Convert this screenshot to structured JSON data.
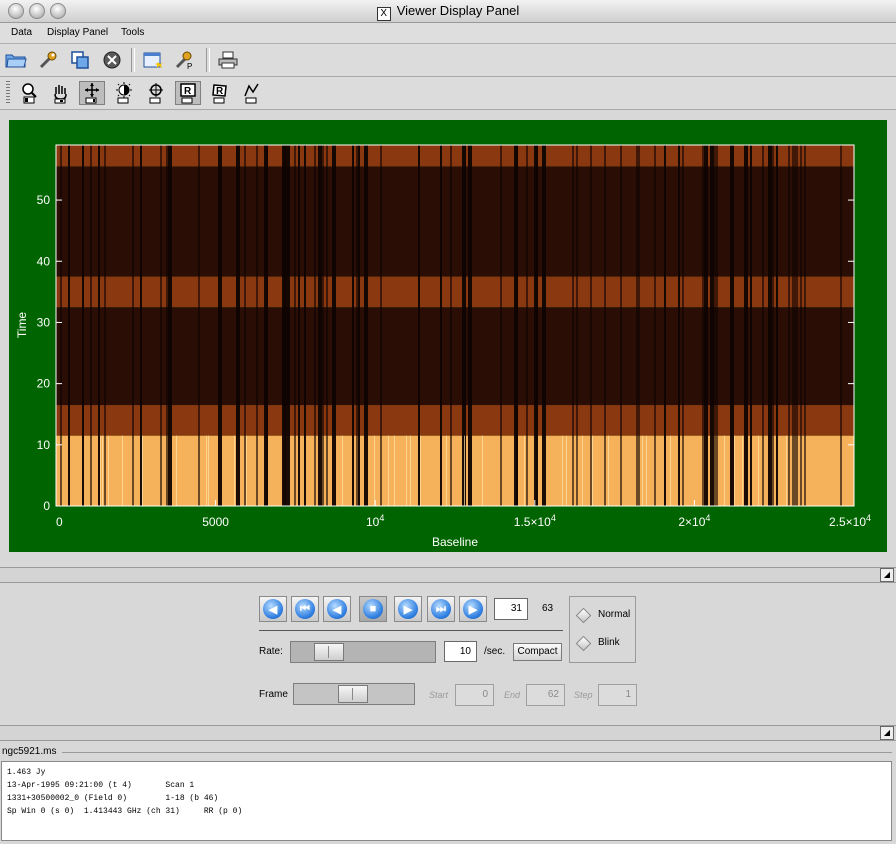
{
  "window": {
    "title": "Viewer Display Panel"
  },
  "menubar": {
    "items": [
      "Data",
      "Display Panel",
      "Tools"
    ]
  },
  "toolbar1": {
    "icons": [
      "open-folder-icon",
      "wrench-icon",
      "copy-panels-icon",
      "close-circle-icon",
      "new-panel-icon",
      "panel-wrench-icon",
      "printer-icon"
    ]
  },
  "toolbar2": {
    "icons": [
      "zoom-icon",
      "pan-hand-icon",
      "move-cross-icon",
      "contrast-icon",
      "crosshair-icon",
      "rectangle-region-icon",
      "polygon-region-icon",
      "polyline-icon"
    ],
    "pressed_index": 2
  },
  "plot": {
    "x_label": "Baseline",
    "y_label": "Time",
    "x_ticks": [
      "0",
      "5000",
      "10",
      "1.5×10",
      "2×10",
      "2.5×10"
    ],
    "x_tick_sup": "4",
    "y_ticks": [
      "0",
      "10",
      "20",
      "30",
      "40",
      "50"
    ],
    "x_range": [
      0,
      25000
    ],
    "y_range": [
      0,
      59
    ],
    "bands": [
      {
        "y0": 0,
        "y1": 11.5,
        "level": "bright"
      },
      {
        "y0": 11.5,
        "y1": 16.5,
        "level": "mid"
      },
      {
        "y0": 16.5,
        "y1": 32.5,
        "level": "dark"
      },
      {
        "y0": 32.5,
        "y1": 37.5,
        "level": "mid"
      },
      {
        "y0": 37.5,
        "y1": 55.5,
        "level": "dark"
      },
      {
        "y0": 55.5,
        "y1": 59,
        "level": "mid"
      }
    ],
    "colors": {
      "bright": "#f5b25a",
      "mid": "#8a3810",
      "dark": "#2a0e06",
      "background": "#006400"
    }
  },
  "animator": {
    "buttons": [
      "rewind-to-start-icon",
      "step-back-fast-icon",
      "play-backward-icon",
      "stop-icon",
      "play-forward-icon",
      "step-forward-fast-icon",
      "go-to-end-icon"
    ],
    "frame_value": "31",
    "total_frames": "63",
    "rate_label": "Rate:",
    "rate_value": "10",
    "rate_unit": "/sec.",
    "compact_label": "Compact",
    "frame_label": "Frame",
    "start_label": "Start",
    "start_value": "0",
    "end_label": "End",
    "end_value": "62",
    "step_label": "Step",
    "step_value": "1",
    "mode_normal": "Normal",
    "mode_blink": "Blink",
    "rate_slider_fraction": 0.2,
    "frame_slider_fraction": 0.49
  },
  "tracking": {
    "file_name": "ngc5921.ms",
    "lines": [
      "1.463 Jy",
      "13-Apr-1995 09:21:00 (t 4)       Scan 1",
      "1331+30500002_0 (Field 0)        1-18 (b 46)",
      "Sp Win 0 (s 0)  1.413443 GHz (ch 31)     RR (p 0)"
    ]
  }
}
